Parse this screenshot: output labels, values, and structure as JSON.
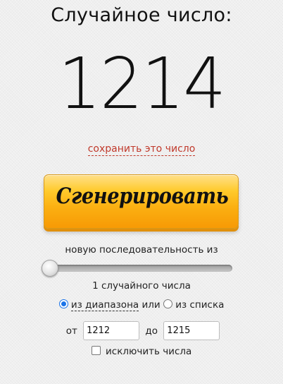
{
  "title": "Случайное число:",
  "result": "1214",
  "save_link": "сохранить это число",
  "generate_button": "Сгенерировать",
  "sequence": {
    "label": "новую последовательность из",
    "count_label": "1 случайного числа"
  },
  "mode": {
    "range_label": "из диапазона",
    "or_text": "или",
    "list_label": "из списка",
    "selected": "range"
  },
  "range": {
    "from_label": "от",
    "from_value": "1212",
    "to_label": "до",
    "to_value": "1215"
  },
  "exclude_label": "исключить числа",
  "colors": {
    "link": "#c0392b",
    "button_top": "#ffd24a",
    "button_bottom": "#f79a05",
    "radio_accent": "#1a73e8"
  }
}
